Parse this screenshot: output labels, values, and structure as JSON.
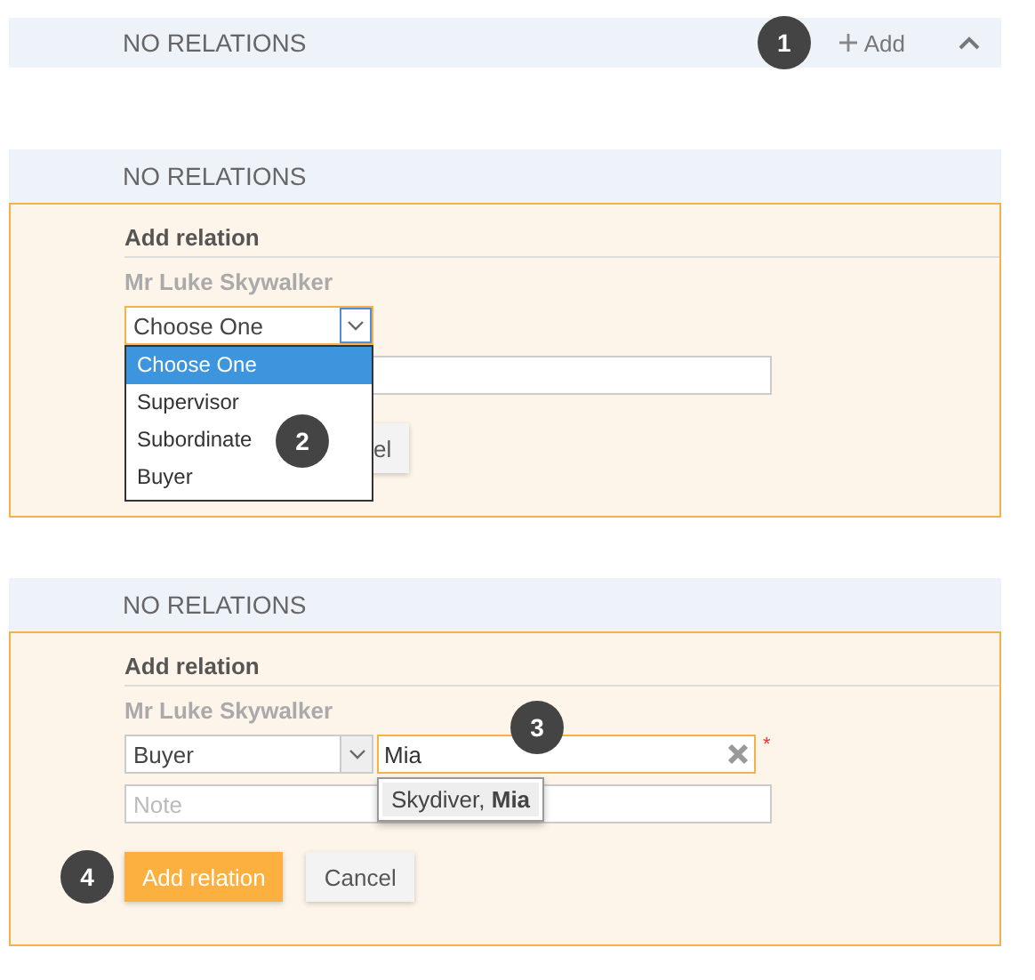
{
  "panels": [
    {
      "kind": "header_only",
      "title": "NO RELATIONS",
      "badge": "1",
      "add_label": "Add"
    },
    {
      "kind": "form",
      "title": "NO RELATIONS",
      "form_title": "Add relation",
      "person": "Mr Luke Skywalker",
      "type_select": {
        "value": "Choose One",
        "focused": true,
        "open": true,
        "badge": "2",
        "options": [
          {
            "label": "Choose One",
            "selected": true
          },
          {
            "label": "Supervisor",
            "selected": false
          },
          {
            "label": "Subordinate",
            "selected": false
          },
          {
            "label": "Buyer",
            "selected": false
          }
        ]
      },
      "buttons": [
        {
          "label": "el",
          "kind": "partial"
        }
      ]
    },
    {
      "kind": "form",
      "title": "NO RELATIONS",
      "form_title": "Add relation",
      "person": "Mr Luke Skywalker",
      "type_select": {
        "value": "Buyer",
        "focused": false,
        "open": false
      },
      "search": {
        "value": "Mia",
        "badge": "3",
        "required_mark": "*",
        "suggestions": [
          "Skydiver, **Mia**"
        ]
      },
      "note_placeholder": "Note",
      "buttons": [
        {
          "label": "Add relation",
          "kind": "primary",
          "badge": "4"
        },
        {
          "label": "Cancel",
          "kind": "secondary"
        }
      ]
    }
  ]
}
